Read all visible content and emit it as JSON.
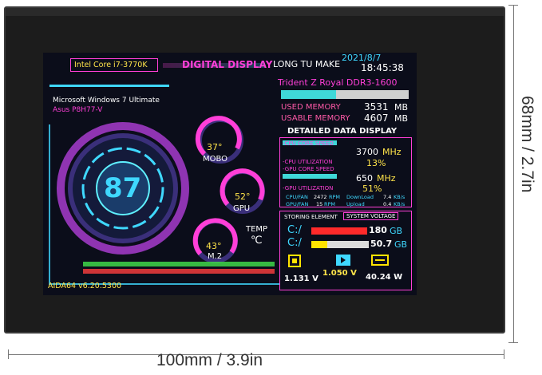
{
  "dimensions": {
    "width_label": "100mm / 3.9in",
    "height_label": "68mm / 2.7in"
  },
  "screen": {
    "cpu_name": "Intel Core i7-3770K",
    "title": "DIGITAL DISPLAY",
    "brand": "LONG TU MAKE",
    "date": "2021/8/7",
    "time": "18:45:38",
    "os": "Microsoft Windows 7 Ultimate",
    "board": "Asus P8H77-V",
    "main_gauge": "87",
    "mobo": {
      "value": "37°",
      "label": "MOBO"
    },
    "gpu": {
      "value": "52°",
      "label": "GPU"
    },
    "m2": {
      "value": "43°",
      "label": "M.2"
    },
    "temp": {
      "label": "TEMP",
      "unit": "℃"
    },
    "version": "AIDA64 v6.20.5300",
    "ram": {
      "name": "Trident Z Royal DDR3-1600",
      "used_label": "USED MEMORY",
      "used_value": "3531",
      "used_unit": "MB",
      "usable_label": "USABLE MEMORY",
      "usable_value": "4607",
      "usable_unit": "MB",
      "used_fraction": 0.43
    },
    "detail": {
      "heading": "DETAILED DATA DISPLAY",
      "cpu_speed_label": "-CPU CORE SPEED",
      "cpu_speed_value": "3700",
      "cpu_speed_unit": "MHz",
      "cpu_util_label": "-CPU UTILIZATION",
      "cpu_util_value": "13%",
      "gpu_speed_label": "-GPU CORE SPEED",
      "gpu_speed_value": "650",
      "gpu_speed_unit": "MHz",
      "gpu_util_label": "-GPU UTILIZATION",
      "gpu_util_value": "51%",
      "cpu_fan_label": "CPU/FAN",
      "cpu_fan_value": "2472",
      "cpu_fan_unit": "RPM",
      "gpu_fan_label": "GPU/FAN",
      "gpu_fan_value": "15",
      "gpu_fan_unit": "RPM",
      "download_label": "DownLoad",
      "download_value": "7.4",
      "download_unit": "KB/s",
      "upload_label": "Upload",
      "upload_value": "0.4",
      "upload_unit": "KB/s"
    },
    "storage": {
      "heading": "STORING ELEMENT",
      "drives": [
        {
          "label": "C:/",
          "value": "180",
          "unit": "GB",
          "color": "#ff2a2a"
        },
        {
          "label": "C:/",
          "value": "50.7",
          "unit": "GB",
          "color": "#ffe400"
        }
      ]
    },
    "voltage": {
      "heading": "SYSTEM VOLTAGE",
      "v1": "1.131 V",
      "v2": "1.050 V",
      "v3": "40.24 W"
    }
  }
}
